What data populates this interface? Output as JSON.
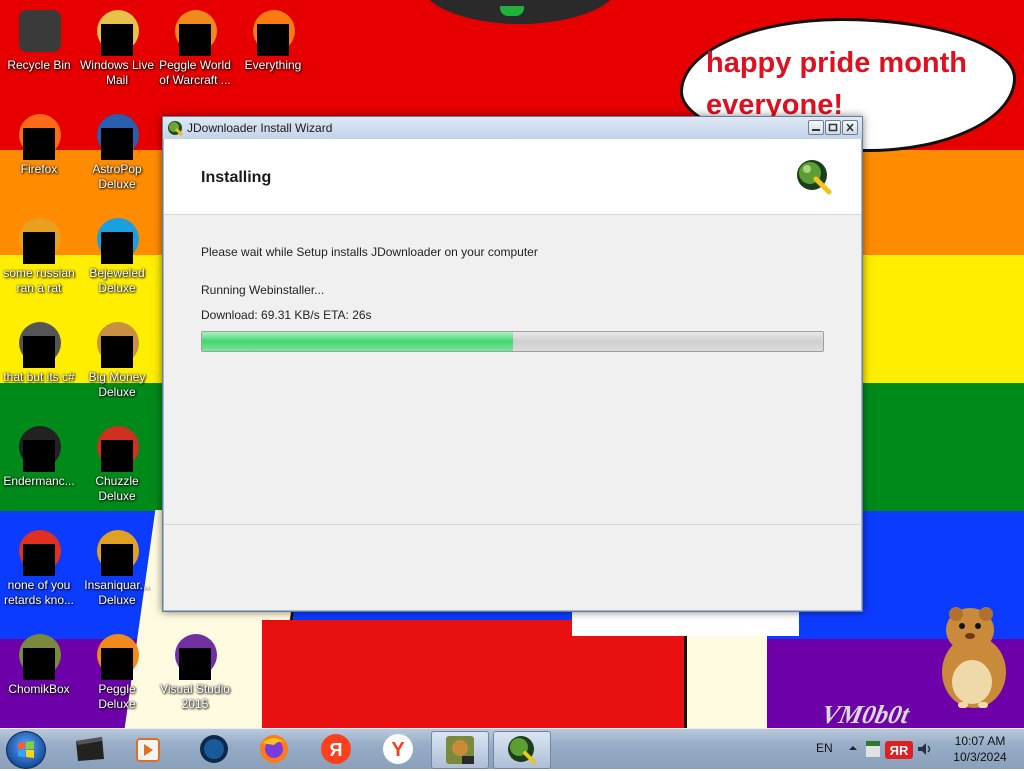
{
  "desktop": {
    "icons": [
      {
        "label": "Recycle Bin",
        "icon": "recycle-bin-icon"
      },
      {
        "label": "Windows Live Mail",
        "icon": "mail-icon"
      },
      {
        "label": "Peggle World of Warcraft ...",
        "icon": "peggle-icon"
      },
      {
        "label": "Everything",
        "icon": "search-app-icon"
      },
      {
        "label": "Firefox",
        "icon": "firefox-icon"
      },
      {
        "label": "AstroPop Deluxe",
        "icon": "game-icon"
      },
      {
        "label": "some russian ran a rat",
        "icon": "app-icon"
      },
      {
        "label": "Bejeweled Deluxe",
        "icon": "gem-icon"
      },
      {
        "label": "that but its c#",
        "icon": "windows-icon"
      },
      {
        "label": "Big Money Deluxe",
        "icon": "money-bag-icon"
      },
      {
        "label": "Endermanc...",
        "icon": "terminal-icon"
      },
      {
        "label": "Chuzzle Deluxe",
        "icon": "game-icon"
      },
      {
        "label": "none of you retards kno...",
        "icon": "app-icon"
      },
      {
        "label": "Insaniquar... Deluxe",
        "icon": "fish-icon"
      },
      {
        "label": "ChomikBox",
        "icon": "chomikbox-icon"
      },
      {
        "label": "Peggle Deluxe",
        "icon": "peggle-icon"
      },
      {
        "label": "Visual Studio 2015",
        "icon": "visual-studio-icon"
      }
    ]
  },
  "wallpaper": {
    "bubble_text": "happy pride month everyone!",
    "watermark": "VM0b0t",
    "colors": [
      "#e60000",
      "#ff8c00",
      "#ffee00",
      "#008a1a",
      "#0b3bff",
      "#6d00a8"
    ]
  },
  "installer": {
    "title": "JDownloader Install Wizard",
    "heading": "Installing",
    "message": "Please wait while Setup installs JDownloader on your computer",
    "status": "Running Webinstaller...",
    "download_info": "Download: 69.31 KB/s ETA: 26s",
    "progress": 0.5,
    "accent": "#43d46e"
  },
  "taskbar": {
    "items": [
      "start-orb",
      "explorer",
      "media-player",
      "app",
      "firefox",
      "yandex",
      "yandex-browser",
      "chomikbox",
      "jdownloader"
    ],
    "language": "EN",
    "time": "10:07 AM",
    "date": "10/3/2024"
  }
}
